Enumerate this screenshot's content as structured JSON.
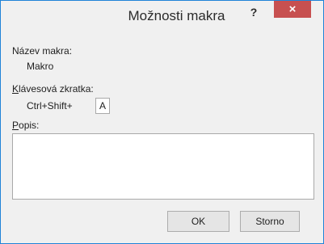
{
  "window": {
    "title": "Možnosti makra",
    "help_label": "?",
    "close_label": "×"
  },
  "macro": {
    "name_label": "Název makra:",
    "name_value": "Makro"
  },
  "shortcut": {
    "label_first": "K",
    "label_rest": "lávesová zkratka:",
    "prefix": "Ctrl+Shift+",
    "key_value": "A"
  },
  "description": {
    "label_first": "P",
    "label_rest": "opis:",
    "value": ""
  },
  "buttons": {
    "ok": "OK",
    "cancel": "Storno"
  }
}
